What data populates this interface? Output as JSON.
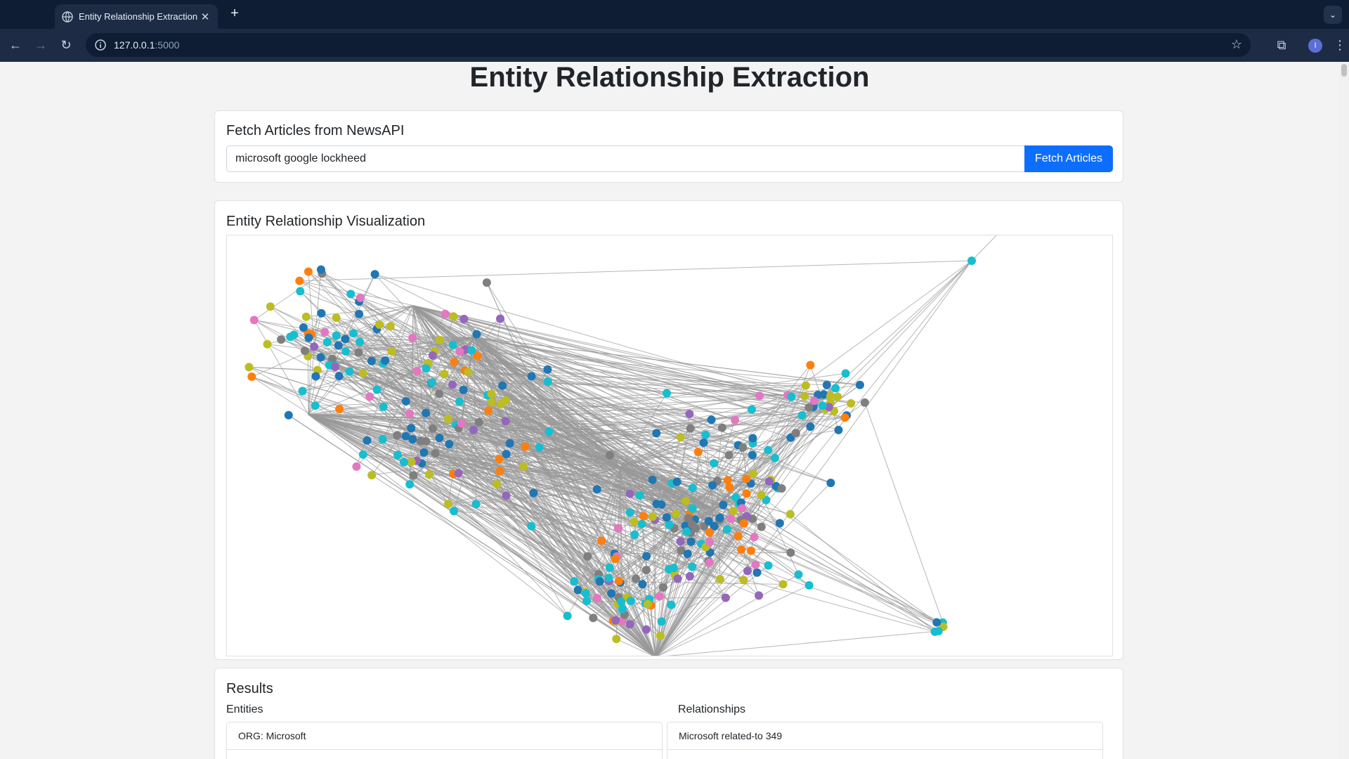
{
  "browser": {
    "tab_title": "Entity Relationship Extraction",
    "tab_close": "✕",
    "new_tab": "+",
    "url_host": "127.0.0.1",
    "url_port": ":5000",
    "profile_initial": "I"
  },
  "page": {
    "title": "Entity Relationship Extraction"
  },
  "fetch": {
    "heading": "Fetch Articles from NewsAPI",
    "query_value": "microsoft google lockheed",
    "button_label": "Fetch Articles"
  },
  "visualization": {
    "heading": "Entity Relationship Visualization",
    "node_colors": [
      "#17becf",
      "#1f77b4",
      "#bcbd22",
      "#7f7f7f",
      "#ff7f0e",
      "#e377c2",
      "#9467bd"
    ],
    "edge_color": "#999999"
  },
  "results": {
    "heading": "Results",
    "entities_title": "Entities",
    "relationships_title": "Relationships",
    "entities": [
      "ORG: Microsoft",
      ""
    ],
    "relationships": [
      "Microsoft related-to 349",
      ""
    ]
  }
}
